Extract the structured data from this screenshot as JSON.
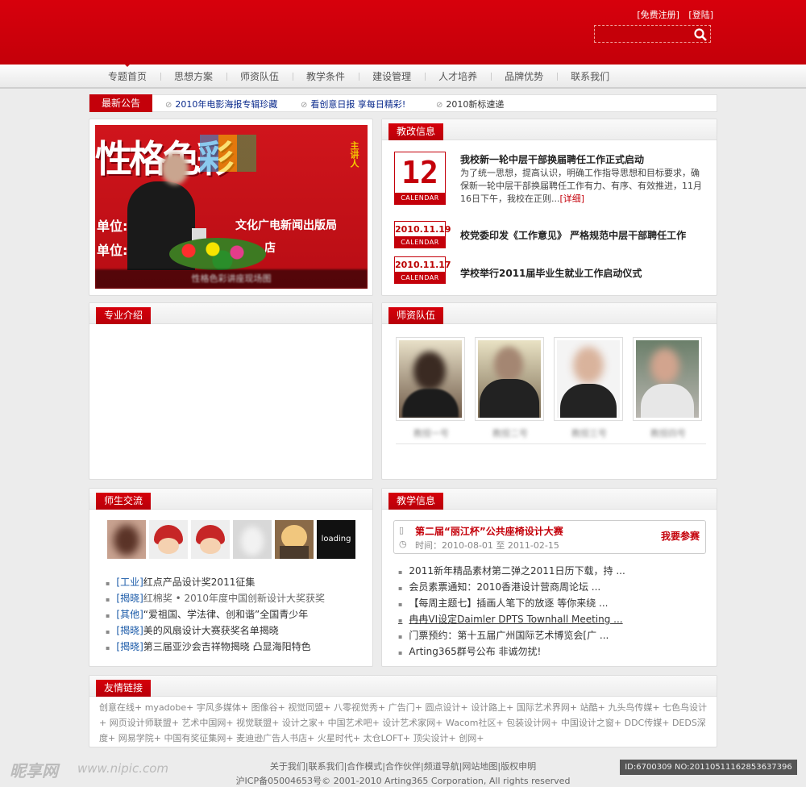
{
  "header": {
    "register": "[免费注册]",
    "login": "[登陆]",
    "search_placeholder": ""
  },
  "nav": [
    "专题首页",
    "思想方案",
    "师资队伍",
    "教学条件",
    "建设管理",
    "人才培养",
    "品牌优势",
    "联系我们"
  ],
  "announcement": {
    "tag": "最新公告",
    "items": [
      "2010年电影海报专辑珍藏",
      "看创意日报 享每日精彩!",
      "2010新标速递"
    ]
  },
  "slideshow": {
    "banner_text": "性格色彩",
    "side_text": "主讲人",
    "line1": "单位:",
    "line2": "单位:",
    "org": "文化广电新闻出版局",
    "org2": "店",
    "caption": "性格色彩讲座现场图"
  },
  "reform": {
    "tab": "教改信息",
    "cal_word": "CALENDAR",
    "lead": {
      "day": "12",
      "title": "我校新一轮中层干部换届聘任工作正式启动",
      "body": "为了统一思想，提高认识，明确工作指导思想和目标要求，确保新一轮中层干部换届聘任工作有力、有序、有效推进，11月16日下午，我校在正则...",
      "more": "[详细]"
    },
    "items": [
      {
        "date": "2010.11.19",
        "title": "校党委印发《工作意见》 严格规范中层干部聘任工作"
      },
      {
        "date": "2010.11.17",
        "title": "学校举行2011届毕业生就业工作启动仪式"
      }
    ]
  },
  "major": {
    "tab": "专业介绍"
  },
  "faculty": {
    "tab": "师资队伍",
    "names": [
      "教授一号",
      "教授二号",
      "教授三号",
      "教授四号"
    ]
  },
  "exchange": {
    "tab": "师生交流",
    "loading": "loading",
    "news": [
      {
        "cat": "[工业]",
        "text": "红点产品设计奖2011征集"
      },
      {
        "cat": "[揭晓]",
        "text": "红棉奖 • 2010年度中国创新设计大奖获奖"
      },
      {
        "cat": "[其他]",
        "text": "“爱祖国、学法律、创和谐”全国青少年"
      },
      {
        "cat": "[揭晓]",
        "text": "美的风扇设计大赛获奖名单揭晓"
      },
      {
        "cat": "[揭晓]",
        "text": "第三届亚沙会吉祥物揭晓 凸显海阳特色"
      }
    ]
  },
  "teaching": {
    "tab": "教学信息",
    "competition": {
      "title": "第二届“丽江杯”公共座椅设计大赛",
      "join": "我要参赛",
      "time": "时间：2010-08-01 至 2011-02-15"
    },
    "news": [
      "2011新年精品素材第二弹之2011日历下载，持 ...",
      "会员素票通知：2010香港设计营商周论坛 ...",
      "【每周主题七】插画人笔下的放逐 等你来绕 ...",
      "冉冉VI设定Daimler DPTS Townhall Meeting ...",
      "门票预约：第十五届广州国际艺术博览会[广 ...",
      "Arting365群号公布 非诚勿扰!"
    ]
  },
  "links": {
    "tab": "友情链接",
    "items": [
      "创意在线",
      "myadobe",
      "宇风多媒体",
      "图像谷",
      "视觉同盟",
      "八零视觉秀",
      "广告门",
      "圆点设计",
      "设计路上",
      "国际艺术界网",
      "站酷",
      "九头鸟传媒",
      "七色鸟设计",
      "网页设计师联盟",
      "艺术中国网",
      "视觉联盟",
      "设计之家",
      "中国艺术吧",
      "设计艺术家网",
      "Wacom社区",
      "包装设计网",
      "中国设计之窗",
      "DDC传媒",
      "DEDS深度",
      "网易学院",
      "中国有奖征集网",
      "麦迪逊广告人书店",
      "火星时代",
      "太仓LOFT",
      "顶尖设计",
      "创网"
    ]
  },
  "footer": {
    "links": "关于我们|联系我们|合作模式|合作伙伴|频道导航|网站地图|版权申明",
    "copy": "沪ICP备05004653号© 2001-2010 Arting365 Corporation, All rights reserved"
  },
  "watermark": {
    "brand": "昵享网",
    "url": "www.nipic.com",
    "id": "ID:6700309 NO:20110511162853637396"
  },
  "colors": {
    "brand_red": "#c4000a"
  }
}
